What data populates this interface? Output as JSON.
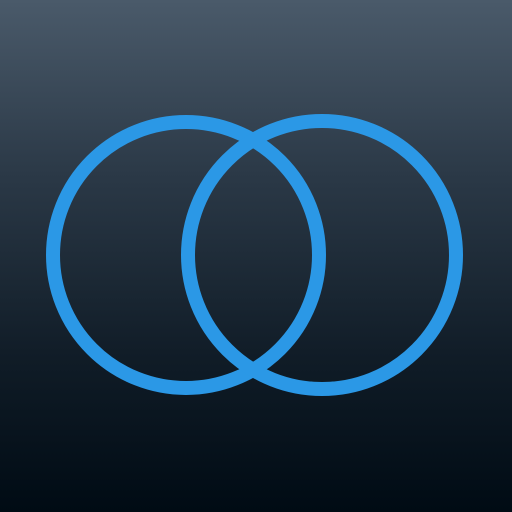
{
  "icon": {
    "name": "overlapping-circles-logo",
    "colors": {
      "background_top": "#4a5a6a",
      "background_bottom": "#000b14",
      "ring": "#2b98e6"
    }
  }
}
